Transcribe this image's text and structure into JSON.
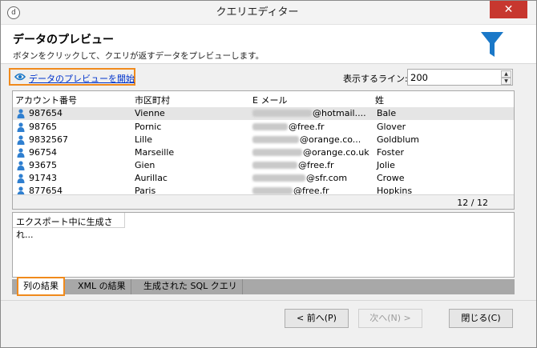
{
  "window": {
    "title": "クエリエディター",
    "app_icon_glyph": "d",
    "close_glyph": "✕",
    "close_color": "#c7372f"
  },
  "header": {
    "title": "データのプレビュー",
    "subtitle": "ボタンをクリックして、クエリが返すデータをプレビューします。",
    "icon": "funnel-icon",
    "icon_color": "#1a78c8"
  },
  "toolbar": {
    "preview_link": "データのプレビューを開始",
    "lines_label": "表示するライン:",
    "lines_value": "200",
    "highlight_color": "#f08a1c"
  },
  "grid": {
    "columns": [
      "アカウント番号",
      "市区町村",
      "E メール",
      "姓"
    ],
    "rows": [
      {
        "account": "987654",
        "city": "Vienne",
        "email_visible": "@hotmail....",
        "surname": "Bale"
      },
      {
        "account": "98765",
        "city": "Pornic",
        "email_visible": "@free.fr",
        "surname": "Glover"
      },
      {
        "account": "9832567",
        "city": "Lille",
        "email_visible": "@orange.co...",
        "surname": "Goldblum"
      },
      {
        "account": "96754",
        "city": "Marseille",
        "email_visible": "@orange.co.uk",
        "surname": "Foster"
      },
      {
        "account": "93675",
        "city": "Gien",
        "email_visible": "@free.fr",
        "surname": "Jolie"
      },
      {
        "account": "91743",
        "city": "Aurillac",
        "email_visible": "@sfr.com",
        "surname": "Crowe"
      },
      {
        "account": "877654",
        "city": "Paris",
        "email_visible": "@free.fr",
        "surname": "Hopkins"
      }
    ],
    "row_count": "12 / 12"
  },
  "export": {
    "status": "エクスポート中に生成され..."
  },
  "tabs": [
    {
      "label": "列の結果",
      "active": true
    },
    {
      "label": "XML の結果",
      "active": false
    },
    {
      "label": "生成された SQL クエリ",
      "active": false
    }
  ],
  "buttons": {
    "prev": "< 前へ(P)",
    "next": "次へ(N) >",
    "close": "閉じる(C)"
  }
}
